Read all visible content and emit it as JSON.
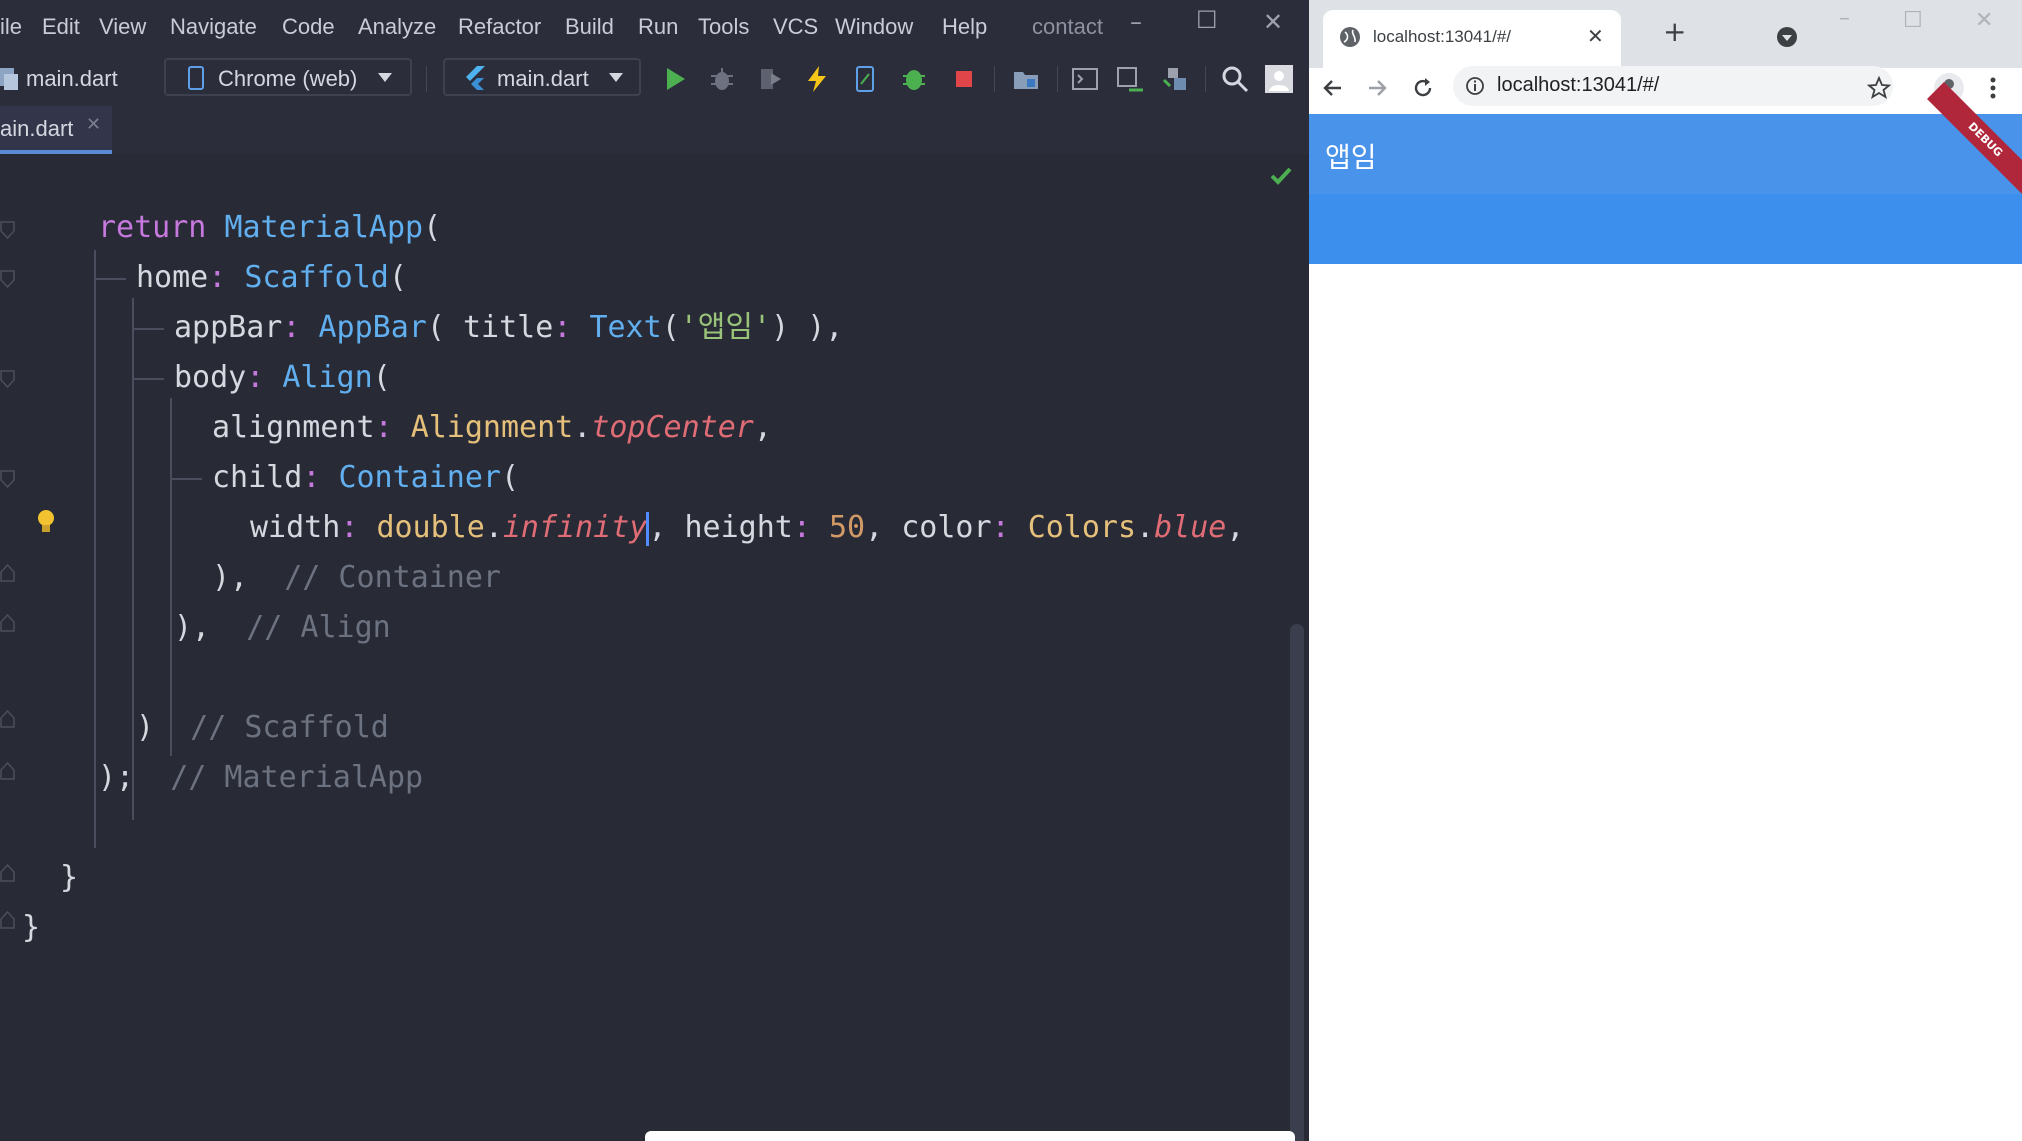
{
  "ide": {
    "menu": [
      "ile",
      "Edit",
      "View",
      "Navigate",
      "Code",
      "Analyze",
      "Refactor",
      "Build",
      "Run",
      "Tools",
      "VCS",
      "Window",
      "Help"
    ],
    "project_title": "contact",
    "toolbar": {
      "project_file": "main.dart",
      "device": "Chrome (web)",
      "run_config": "main.dart"
    },
    "tab_label": "ain.dart",
    "code": {
      "l1": [
        "return",
        " ",
        "MaterialApp",
        "("
      ],
      "l2": [
        "home",
        ": ",
        "Scaffold",
        "("
      ],
      "l3": [
        "appBar",
        ": ",
        "AppBar",
        "( ",
        "title",
        ": ",
        "Text",
        "(",
        "'앱임'",
        ") ),"
      ],
      "l4": [
        "body",
        ": ",
        "Align",
        "("
      ],
      "l5": [
        "alignment",
        ": ",
        "Alignment",
        ".",
        "topCenter",
        ","
      ],
      "l6": [
        "child",
        ": ",
        "Container",
        "("
      ],
      "l7": [
        "width",
        ": ",
        "double",
        ".",
        "infinity",
        ", ",
        "height",
        ": ",
        "50",
        ", ",
        "color",
        ": ",
        "Colors",
        ".",
        "blue",
        ","
      ],
      "l8": [
        "),",
        "  // Container"
      ],
      "l9": [
        "),",
        "  // Align"
      ],
      "l10": [
        ")",
        "  // Scaffold"
      ],
      "l11": [
        ");",
        "  // MaterialApp"
      ],
      "l12": [
        "}"
      ],
      "l13": [
        "}"
      ]
    }
  },
  "browser": {
    "tab_title": "localhost:13041/#/",
    "address": "localhost:13041/#/",
    "app_title": "앱임",
    "debug_label": "DEBUG"
  },
  "colors": {
    "editor_bg": "#282a36",
    "app_bar_blue": "#4a93ea",
    "container_blue": "#3d8fed",
    "debug_banner": "#b0263a"
  }
}
